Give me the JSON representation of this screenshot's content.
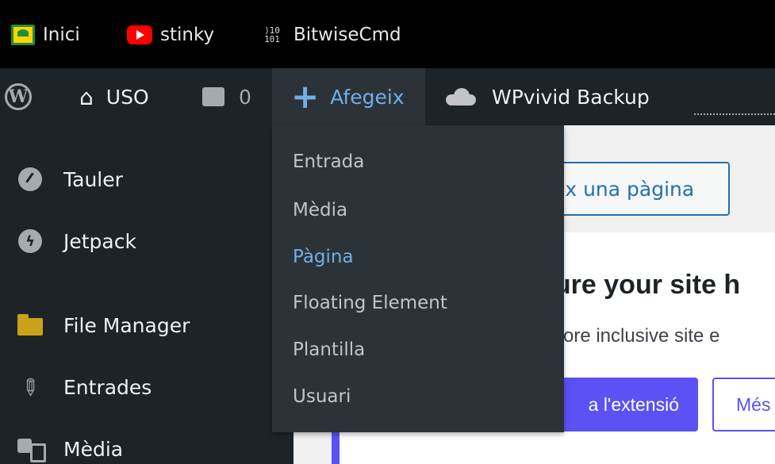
{
  "bookmarks": [
    {
      "label": "Inici",
      "icon": "classroom-icon"
    },
    {
      "label": "stinky",
      "icon": "youtube-icon"
    },
    {
      "label": "BitwiseCmd",
      "icon": "binary-icon",
      "icon_text": "⟩10 101"
    }
  ],
  "adminbar": {
    "site_name": "USO",
    "comments_count": "0",
    "new_label": "Afegeix",
    "wpvivid_label": "WPvivid Backup"
  },
  "new_menu": {
    "items": [
      "Entrada",
      "Mèdia",
      "Pàgina",
      "Floating Element",
      "Plantilla",
      "Usuari"
    ],
    "active_index": 2
  },
  "sidebar": {
    "items": [
      {
        "label": "Tauler",
        "icon": "dashboard-icon"
      },
      {
        "label": "Jetpack",
        "icon": "jetpack-icon"
      },
      {
        "label": "File Manager",
        "icon": "folder-icon"
      },
      {
        "label": "Entrades",
        "icon": "pin-icon"
      },
      {
        "label": "Mèdia",
        "icon": "media-icon"
      }
    ]
  },
  "content": {
    "add_page_button": "eix una pàgina",
    "notice_title": "sure your site h",
    "notice_text": "more inclusive site e",
    "notice_primary": "a l'extensió",
    "notice_secondary": "Més"
  },
  "colors": {
    "adminbar_bg": "#1d2327",
    "submenu_bg": "#2c3338",
    "link_blue": "#72aee6",
    "accent_purple": "#5b51f5",
    "wp_blue": "#2271b1"
  }
}
